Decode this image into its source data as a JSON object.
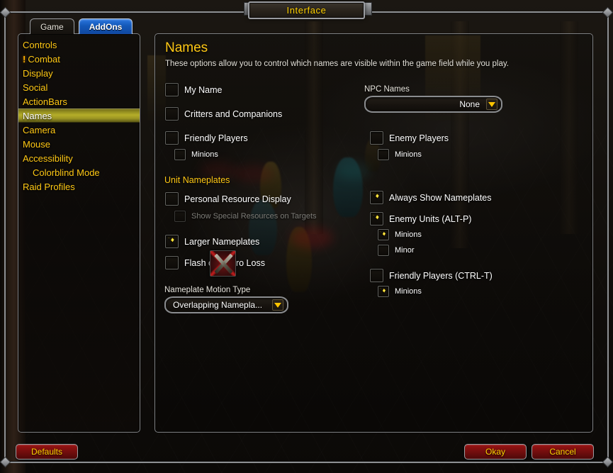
{
  "window": {
    "title": "Interface"
  },
  "tabs": [
    {
      "label": "Game",
      "active": false
    },
    {
      "label": "AddOns",
      "active": true
    }
  ],
  "sidebar": {
    "items": [
      {
        "label": "Controls",
        "selected": false,
        "sub": false,
        "alert": false
      },
      {
        "label": "Combat",
        "selected": false,
        "sub": false,
        "alert": true
      },
      {
        "label": "Display",
        "selected": false,
        "sub": false,
        "alert": false
      },
      {
        "label": "Social",
        "selected": false,
        "sub": false,
        "alert": false
      },
      {
        "label": "ActionBars",
        "selected": false,
        "sub": false,
        "alert": false
      },
      {
        "label": "Names",
        "selected": true,
        "sub": false,
        "alert": false
      },
      {
        "label": "Camera",
        "selected": false,
        "sub": false,
        "alert": false
      },
      {
        "label": "Mouse",
        "selected": false,
        "sub": false,
        "alert": false
      },
      {
        "label": "Accessibility",
        "selected": false,
        "sub": false,
        "alert": false
      },
      {
        "label": "Colorblind Mode",
        "selected": false,
        "sub": true,
        "alert": false
      },
      {
        "label": "Raid Profiles",
        "selected": false,
        "sub": false,
        "alert": false
      }
    ]
  },
  "panel": {
    "title": "Names",
    "description": "These options allow you to control which names are visible within the game field while you play.",
    "section_nameplates": "Unit Nameplates"
  },
  "options": {
    "my_name": {
      "label": "My Name",
      "checked": false
    },
    "critters": {
      "label": "Critters and Companions",
      "checked": false
    },
    "friendly_players": {
      "label": "Friendly Players",
      "checked": false
    },
    "friendly_players_minions": {
      "label": "Minions",
      "checked": false
    },
    "enemy_players": {
      "label": "Enemy Players",
      "checked": false
    },
    "enemy_players_minions": {
      "label": "Minions",
      "checked": false
    },
    "personal_resource": {
      "label": "Personal Resource Display",
      "checked": false
    },
    "special_resources": {
      "label": "Show Special Resources on Targets",
      "checked": false,
      "disabled": true
    },
    "larger_nameplates": {
      "label": "Larger Nameplates",
      "checked": true
    },
    "flash_aggro": {
      "label": "Flash on Aggro Loss",
      "checked": false
    },
    "always_show": {
      "label": "Always Show Nameplates",
      "checked": true
    },
    "enemy_units": {
      "label": "Enemy Units (ALT-P)",
      "checked": true
    },
    "enemy_units_minions": {
      "label": "Minions",
      "checked": true
    },
    "enemy_units_minor": {
      "label": "Minor",
      "checked": false
    },
    "friendly_ctrl": {
      "label": "Friendly Players (CTRL-T)",
      "checked": false
    },
    "friendly_ctrl_minions": {
      "label": "Minions",
      "checked": true
    }
  },
  "dropdowns": {
    "npc_names": {
      "label": "NPC Names",
      "value": "None"
    },
    "nameplate_motion": {
      "label": "Nameplate Motion Type",
      "value": "Overlapping Namepla..."
    }
  },
  "buttons": {
    "defaults": "Defaults",
    "okay": "Okay",
    "cancel": "Cancel"
  },
  "colors": {
    "gold": "#ffc814",
    "check": "#ffd400",
    "selected_row": "#b5ae29",
    "tab_active": "#1458b8",
    "button_red": "#770e0e"
  }
}
